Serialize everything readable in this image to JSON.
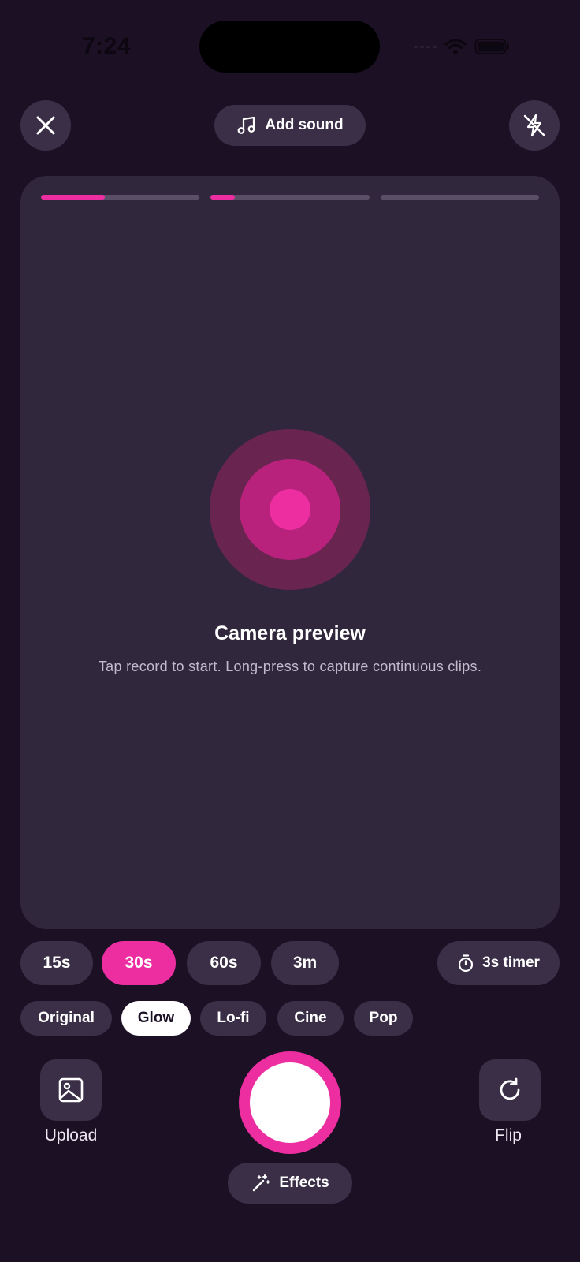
{
  "status_bar": {
    "time": "7:24"
  },
  "header": {
    "close_icon": "close-icon",
    "add_sound_label": "Add sound",
    "flash_icon": "flash-off-icon"
  },
  "preview": {
    "progress_segments": [
      {
        "fill": 0.4
      },
      {
        "fill": 0.15
      },
      {
        "fill": 0
      }
    ],
    "title": "Camera preview",
    "subtitle": "Tap record to start. Long-press to capture continuous clips."
  },
  "durations": {
    "options": [
      "15s",
      "30s",
      "60s",
      "3m"
    ],
    "selected": "30s",
    "timer_label": "3s timer"
  },
  "filters": {
    "options": [
      "Original",
      "Glow",
      "Lo-fi",
      "Cine",
      "Pop"
    ],
    "selected": "Glow"
  },
  "controls": {
    "upload_label": "Upload",
    "flip_label": "Flip",
    "effects_label": "Effects"
  },
  "colors": {
    "background": "#1c1025",
    "surface": "#31273d",
    "button": "#3a2f47",
    "accent": "#ec2ea0"
  }
}
